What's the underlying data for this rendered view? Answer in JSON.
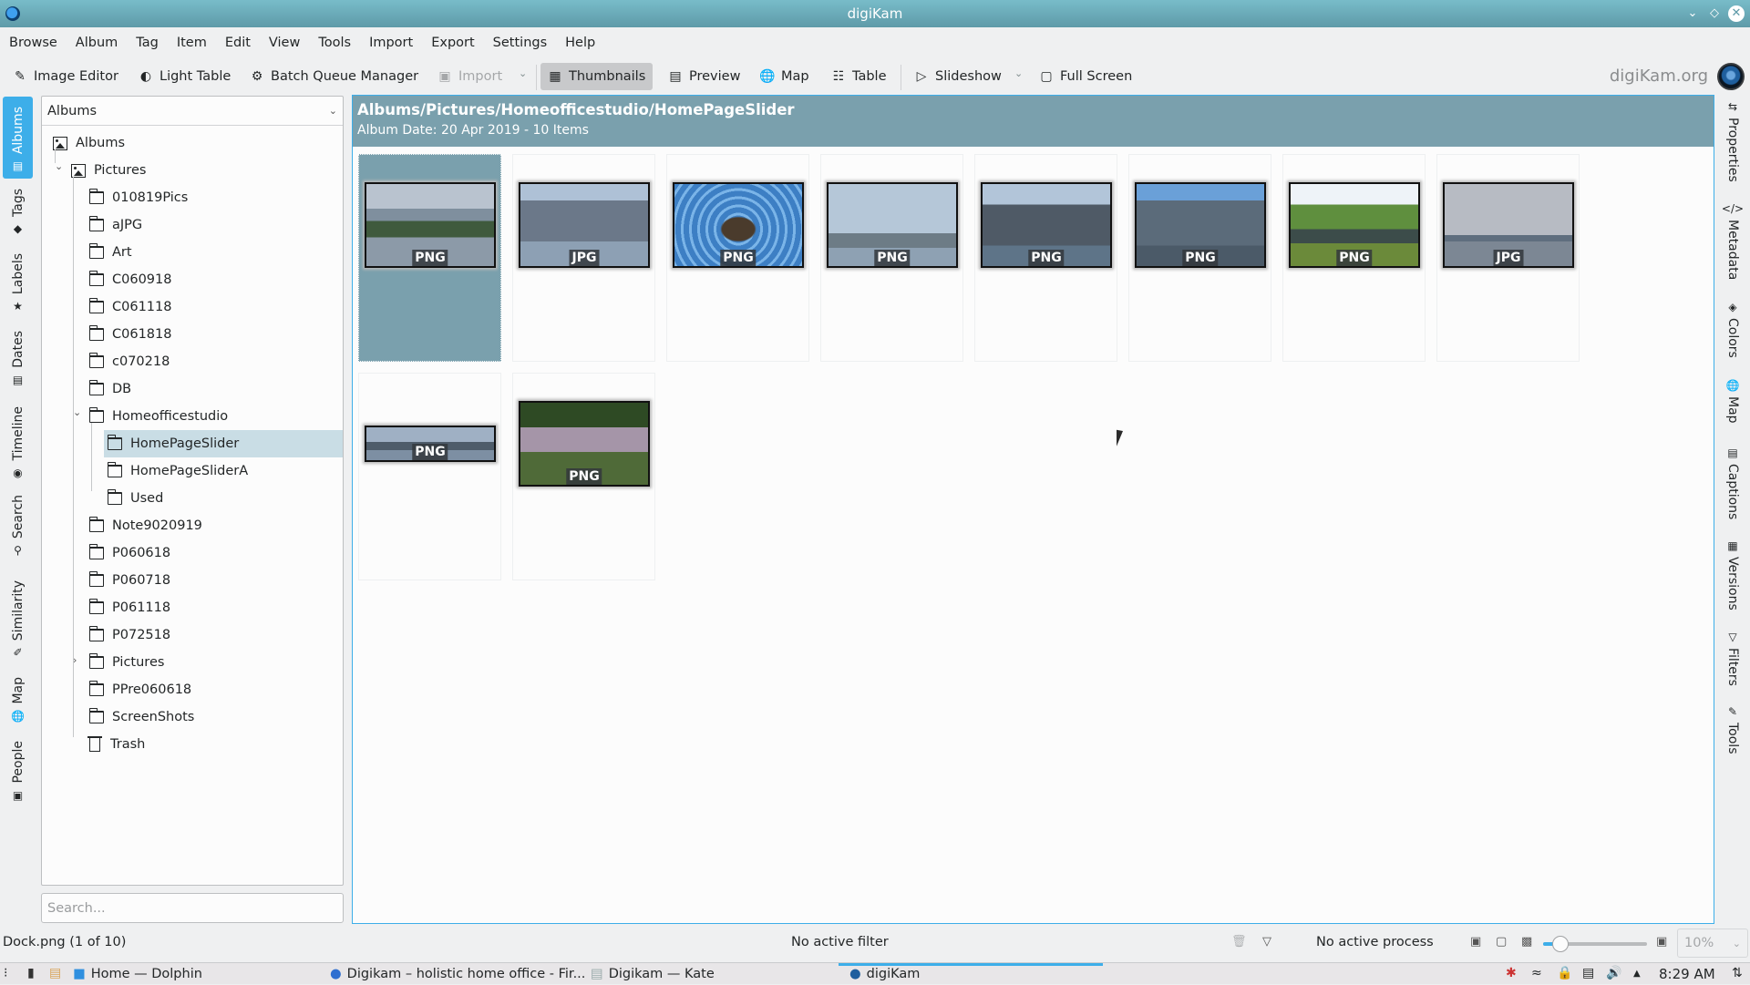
{
  "window": {
    "title": "digiKam",
    "controls": [
      "minimize",
      "maximize",
      "close"
    ]
  },
  "menu": [
    "Browse",
    "Album",
    "Tag",
    "Item",
    "Edit",
    "View",
    "Tools",
    "Import",
    "Export",
    "Settings",
    "Help"
  ],
  "toolbar": {
    "image_editor": "Image Editor",
    "light_table": "Light Table",
    "batch_queue_manager": "Batch Queue Manager",
    "import": "Import",
    "thumbnails": "Thumbnails",
    "preview": "Preview",
    "map": "Map",
    "table": "Table",
    "slideshow": "Slideshow",
    "full_screen": "Full Screen",
    "brand": "digiKam.org"
  },
  "left_tabs": [
    "Albums",
    "Tags",
    "Labels",
    "Dates",
    "Timeline",
    "Search",
    "Similarity",
    "Map",
    "People"
  ],
  "right_tabs": [
    "Properties",
    "Metadata",
    "Colors",
    "Map",
    "Captions",
    "Versions",
    "Filters",
    "Tools"
  ],
  "album_panel": {
    "combo_value": "Albums",
    "search_placeholder": "Search...",
    "tree": [
      {
        "label": "Albums",
        "type": "root",
        "level": 0
      },
      {
        "label": "Pictures",
        "type": "collection",
        "level": 1,
        "expanded": true
      },
      {
        "label": "010819Pics",
        "type": "folder",
        "level": 2
      },
      {
        "label": "aJPG",
        "type": "folder",
        "level": 2
      },
      {
        "label": "Art",
        "type": "folder",
        "level": 2
      },
      {
        "label": "C060918",
        "type": "folder",
        "level": 2
      },
      {
        "label": "C061118",
        "type": "folder",
        "level": 2
      },
      {
        "label": "C061818",
        "type": "folder",
        "level": 2
      },
      {
        "label": "c070218",
        "type": "folder",
        "level": 2
      },
      {
        "label": "DB",
        "type": "folder",
        "level": 2
      },
      {
        "label": "Homeofficestudio",
        "type": "folder",
        "level": 2,
        "expanded": true
      },
      {
        "label": "HomePageSlider",
        "type": "folder",
        "level": 3,
        "selected": true
      },
      {
        "label": "HomePageSliderA",
        "type": "folder",
        "level": 3
      },
      {
        "label": "Used",
        "type": "folder",
        "level": 3
      },
      {
        "label": "Note9020919",
        "type": "folder",
        "level": 2
      },
      {
        "label": "P060618",
        "type": "folder",
        "level": 2
      },
      {
        "label": "P060718",
        "type": "folder",
        "level": 2
      },
      {
        "label": "P061118",
        "type": "folder",
        "level": 2
      },
      {
        "label": "P072518",
        "type": "folder",
        "level": 2
      },
      {
        "label": "Pictures",
        "type": "folder",
        "level": 2,
        "collapsed": true
      },
      {
        "label": "PPre060618",
        "type": "folder",
        "level": 2
      },
      {
        "label": "ScreenShots",
        "type": "folder",
        "level": 2
      },
      {
        "label": "Trash",
        "type": "trash",
        "level": 2
      }
    ]
  },
  "album_view": {
    "path": "Albums/Pictures/Homeofficestudio/HomePageSlider",
    "subtitle": "Album Date: 20 Apr 2019 - 10 Items",
    "items": [
      {
        "format": "PNG",
        "scene": "lake-mountains",
        "selected": true
      },
      {
        "format": "JPG",
        "scene": "city-skyline"
      },
      {
        "format": "PNG",
        "scene": "duck-water"
      },
      {
        "format": "PNG",
        "scene": "space-needle"
      },
      {
        "format": "PNG",
        "scene": "city-waterfront"
      },
      {
        "format": "PNG",
        "scene": "city-towers"
      },
      {
        "format": "PNG",
        "scene": "pond-clouds"
      },
      {
        "format": "JPG",
        "scene": "hazy-bay"
      },
      {
        "format": "PNG",
        "scene": "panorama-skyline"
      },
      {
        "format": "PNG",
        "scene": "marsh-reeds"
      }
    ]
  },
  "statusbar": {
    "current_item": "Dock.png (1 of 10)",
    "filter": "No active filter",
    "process": "No active process",
    "zoom_level": "10%",
    "zoom_fraction": 0.1
  },
  "taskbar": {
    "tasks": [
      "Home — Dolphin",
      "Digikam – holistic home office - Fir...",
      "Digikam  — Kate",
      "digiKam"
    ],
    "clock": "8:29 AM"
  }
}
